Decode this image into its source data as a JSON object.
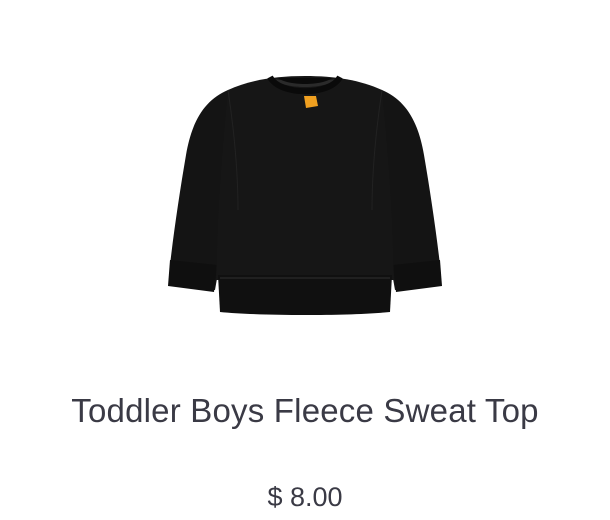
{
  "product": {
    "title": "Toddler Boys Fleece Sweat Top",
    "price": "$ 8.00",
    "image_icon": "sweatshirt-icon",
    "garment_color": "#121212",
    "tag_color": "#f0a020"
  }
}
